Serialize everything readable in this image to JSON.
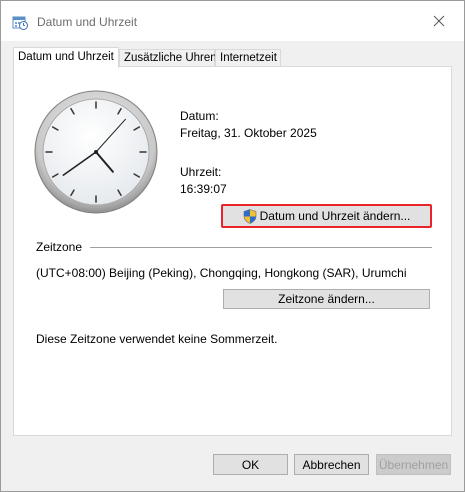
{
  "window": {
    "title": "Datum und Uhrzeit"
  },
  "tabs": [
    {
      "label": "Datum und Uhrzeit",
      "active": true
    },
    {
      "label": "Zusätzliche Uhren",
      "active": false
    },
    {
      "label": "Internetzeit",
      "active": false
    }
  ],
  "datetime": {
    "date_label": "Datum:",
    "date_value": "Freitag, 31. Oktober 2025",
    "time_label": "Uhrzeit:",
    "time_value": "16:39:07",
    "change_button": "Datum und Uhrzeit ändern..."
  },
  "timezone": {
    "heading": "Zeitzone",
    "value": "(UTC+08:00) Beijing (Peking), Chongqing, Hongkong (SAR), Urumchi",
    "change_button": "Zeitzone ändern...",
    "dst_note": "Diese Zeitzone verwendet keine Sommerzeit."
  },
  "footer": {
    "ok": "OK",
    "cancel": "Abbrechen",
    "apply": "Übernehmen"
  },
  "icons": {
    "title": "calendar-clock-icon",
    "close": "close-icon",
    "shield": "uac-shield-icon"
  },
  "colors": {
    "highlight_border": "#e8232a"
  }
}
